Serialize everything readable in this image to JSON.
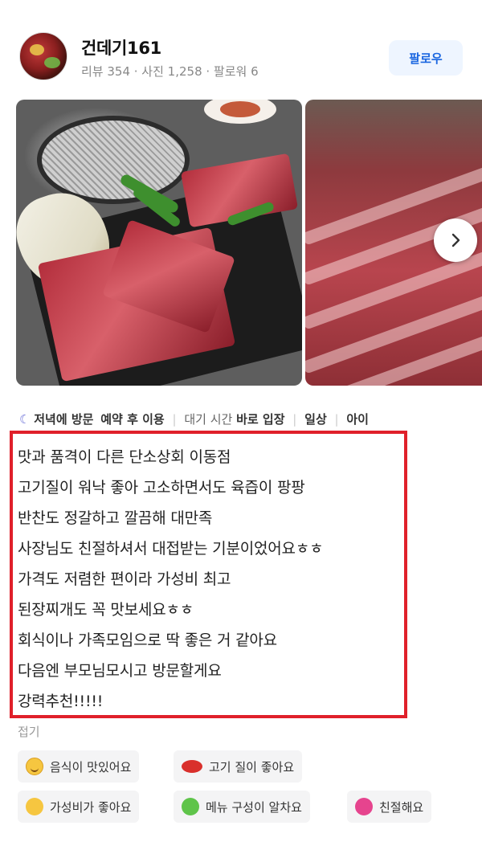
{
  "profile": {
    "username": "건데기161",
    "stats": "리뷰 354 · 사진 1,258 · 팔로워 6",
    "follow_label": "팔로우"
  },
  "visit": {
    "time": "저녁에 방문",
    "reservation": "예약 후 이용",
    "wait_label": "대기 시간",
    "wait_value": "바로 입장",
    "purpose": "일상",
    "with": "아이"
  },
  "review": {
    "lines": [
      "맛과 품격이 다른 단소상회 이동점",
      "고기질이 워낙 좋아 고소하면서도 육즙이 팡팡",
      "반찬도 정갈하고 깔끔해 대만족",
      "사장님도 친절하셔서 대접받는 기분이었어요ㅎㅎ",
      "가격도 저렴한 편이라 가성비 최고",
      "된장찌개도 꼭 맛보세요ㅎㅎ",
      "회식이나 가족모임으로 딱 좋은 거 같아요",
      "다음엔 부모님모시고 방문할게요",
      "강력추천!!!!!"
    ],
    "collapse_label": "접기"
  },
  "tags": [
    {
      "label": "음식이 맛있어요",
      "icon": "smile-emoji-icon"
    },
    {
      "label": "고기 질이 좋아요",
      "icon": "meat-emoji-icon"
    },
    {
      "label": "가성비가 좋아요",
      "icon": "thumbs-up-emoji-icon"
    },
    {
      "label": "메뉴 구성이 알차요",
      "icon": "green-heart-emoji-icon"
    },
    {
      "label": "친절해요",
      "icon": "pink-heart-emoji-icon"
    }
  ],
  "colors": {
    "follow_text": "#1a66e0",
    "follow_bg": "#eef5ff",
    "highlight_border": "#e0202a"
  }
}
